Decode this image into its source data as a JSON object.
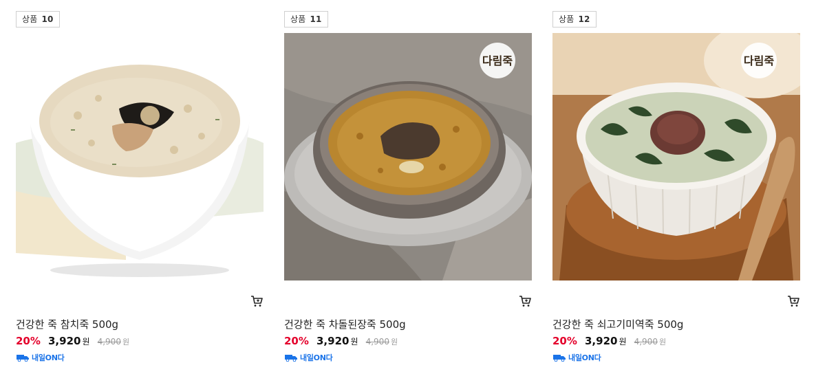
{
  "products": [
    {
      "badge_prefix": "상품",
      "badge_number": "10",
      "name": "건강한 죽 참치죽 500g",
      "discount": "20%",
      "price": "3,920",
      "currency": "원",
      "original_price": "4,900",
      "original_currency": "원",
      "delivery_label": "내일ON다",
      "image_icon": "tuna-porridge-photo",
      "cart_icon": "cart-icon"
    },
    {
      "badge_prefix": "상품",
      "badge_number": "11",
      "name": "건강한 죽 차돌된장죽 500g",
      "discount": "20%",
      "price": "3,920",
      "currency": "원",
      "original_price": "4,900",
      "original_currency": "원",
      "delivery_label": "내일ON다",
      "brand_logo": "다림죽",
      "image_icon": "brisket-doenjang-porridge-photo",
      "cart_icon": "cart-icon"
    },
    {
      "badge_prefix": "상품",
      "badge_number": "12",
      "name": "건강한 죽 쇠고기미역죽 500g",
      "discount": "20%",
      "price": "3,920",
      "currency": "원",
      "original_price": "4,900",
      "original_currency": "원",
      "delivery_label": "내일ON다",
      "brand_logo": "다림죽",
      "image_icon": "beef-seaweed-porridge-photo",
      "cart_icon": "cart-icon"
    }
  ],
  "colors": {
    "discount": "#e4002b",
    "delivery": "#1a73e8",
    "strike": "#999999"
  }
}
